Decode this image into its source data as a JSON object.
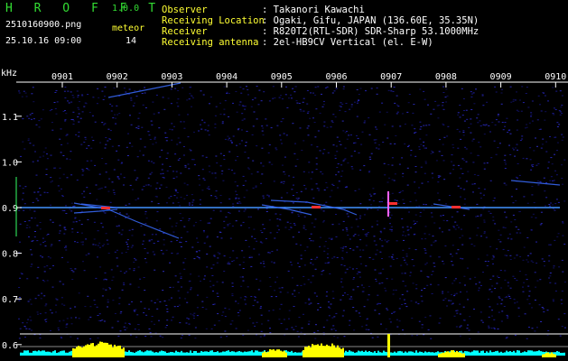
{
  "header": {
    "app_name": "H R O F F T",
    "version": "1.0.0",
    "filename": "2510160900.png",
    "datetime": "25.10.16 09:00",
    "meteor_label": "meteor",
    "meteor_count": "14",
    "info_labels": [
      "Observer",
      "Receiving Location",
      "Receiver",
      "Receiving antenna"
    ],
    "info_values": [
      ": Takanori Kawachi",
      ": Ogaki, Gifu, JAPAN (136.60E, 35.35N)",
      ": R820T2(RTL-SDR) SDR-Sharp 53.1000MHz",
      ": 2el-HB9CV Vertical (el. E-W)"
    ]
  },
  "spectrogram": {
    "y_unit": "kHz",
    "time_labels": [
      "0901",
      "0902",
      "0903",
      "0904",
      "0905",
      "0906",
      "0907",
      "0908",
      "0909",
      "0910"
    ],
    "freq_labels": [
      "1.1",
      "1.0",
      "0.9",
      "0.8",
      "0.7",
      "0.6"
    ],
    "freq_values": [
      1.1,
      1.0,
      0.9,
      0.8,
      0.7,
      0.6
    ],
    "carrier_khz": 0.9,
    "colors": {
      "background": "#000000",
      "grid": "#ffffff",
      "carrier": "#2080ff",
      "signal_peak": "#ff3030",
      "noise": "#1a1a8c",
      "meteor_bar": "#ffff00",
      "noise_floor": "#00ffff"
    }
  }
}
